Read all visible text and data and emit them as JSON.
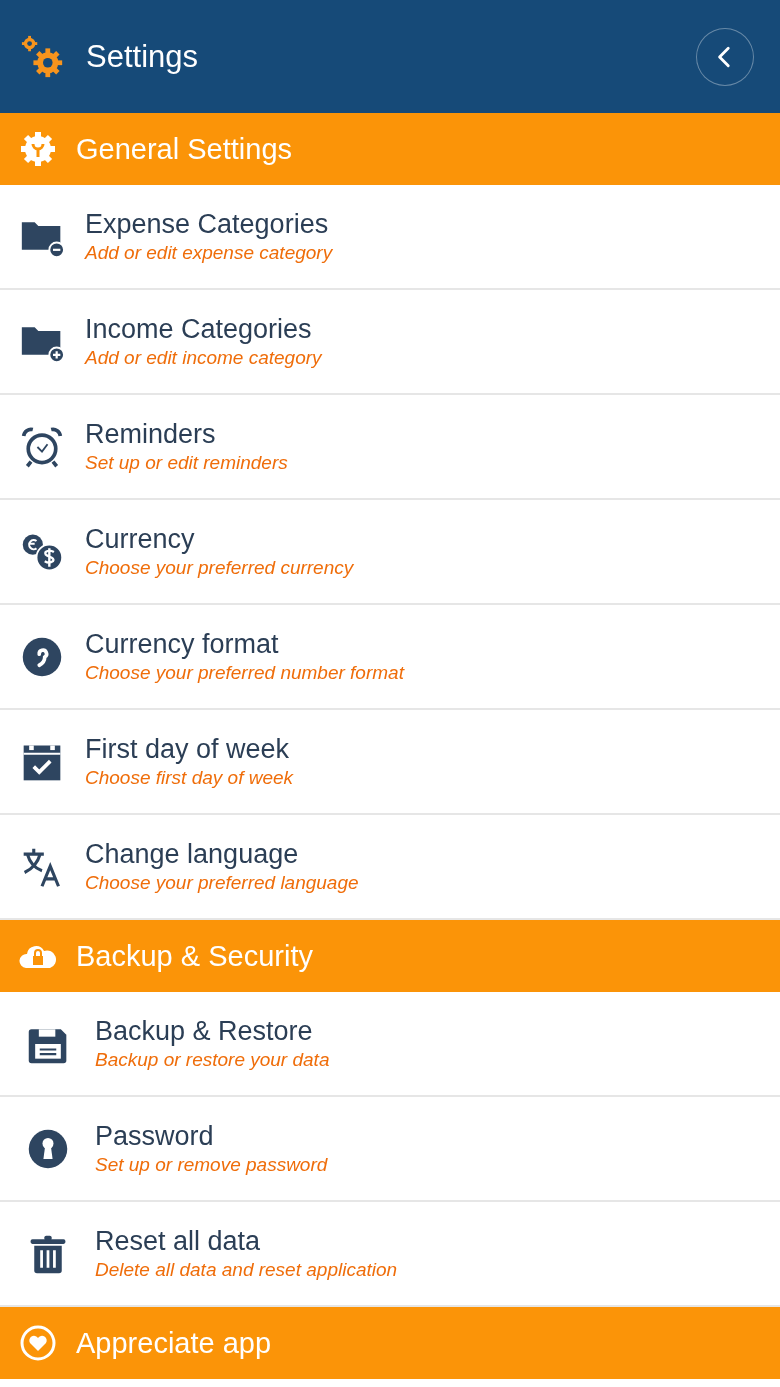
{
  "app_bar": {
    "title": "Settings"
  },
  "sections": [
    {
      "title": "General Settings",
      "items": [
        {
          "title": "Expense Categories",
          "subtitle": "Add or edit expense category"
        },
        {
          "title": "Income Categories",
          "subtitle": "Add or edit income category"
        },
        {
          "title": "Reminders",
          "subtitle": "Set up or edit reminders"
        },
        {
          "title": "Currency",
          "subtitle": "Choose your preferred currency"
        },
        {
          "title": "Currency format",
          "subtitle": "Choose your preferred number format"
        },
        {
          "title": "First day of week",
          "subtitle": "Choose first day of week"
        },
        {
          "title": "Change language",
          "subtitle": "Choose your preferred language"
        }
      ]
    },
    {
      "title": "Backup & Security",
      "items": [
        {
          "title": "Backup & Restore",
          "subtitle": "Backup or restore your data"
        },
        {
          "title": "Password",
          "subtitle": "Set up or remove password"
        },
        {
          "title": "Reset all data",
          "subtitle": "Delete all data and reset application"
        }
      ]
    },
    {
      "title": "Appreciate app"
    }
  ]
}
